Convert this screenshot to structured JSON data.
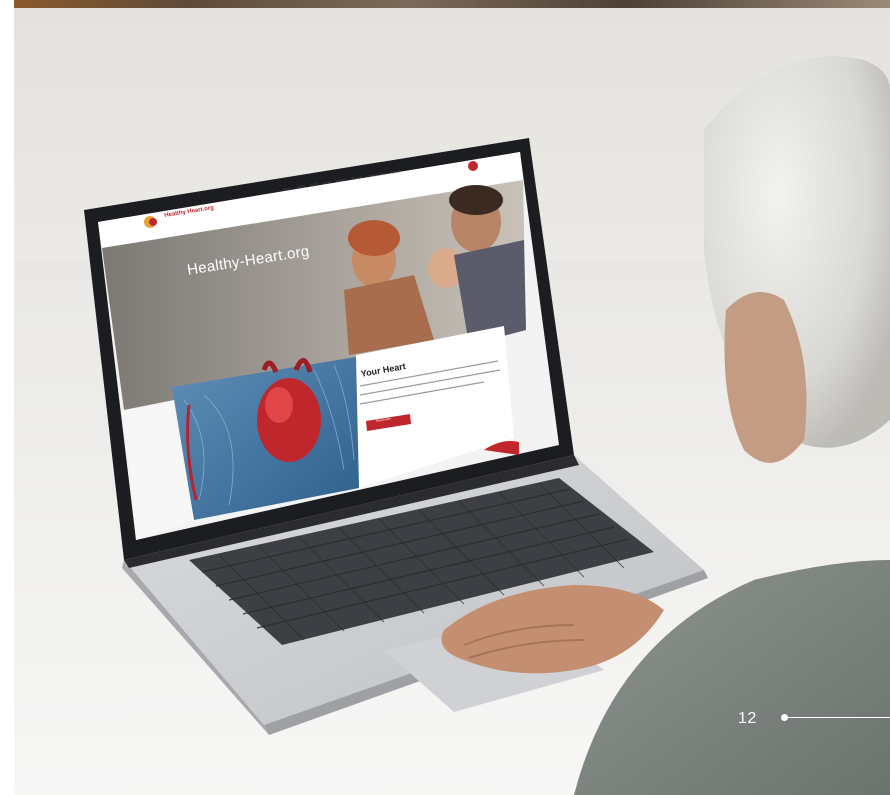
{
  "page": {
    "number": "12"
  },
  "website": {
    "logo_text": "Healthy Heart.org",
    "nav_items": [
      "YOUR HEART",
      "TEST YOUR HEART HEALTH",
      "CONDITIONS",
      "ABOUT"
    ],
    "hero_title": "Healthy-Heart.org",
    "card_title": "Your Heart",
    "card_button": "Read more"
  },
  "colors": {
    "brand_red": "#c0272d",
    "card_bg": "#ffffff",
    "hero_overlay": "#8d8884"
  }
}
